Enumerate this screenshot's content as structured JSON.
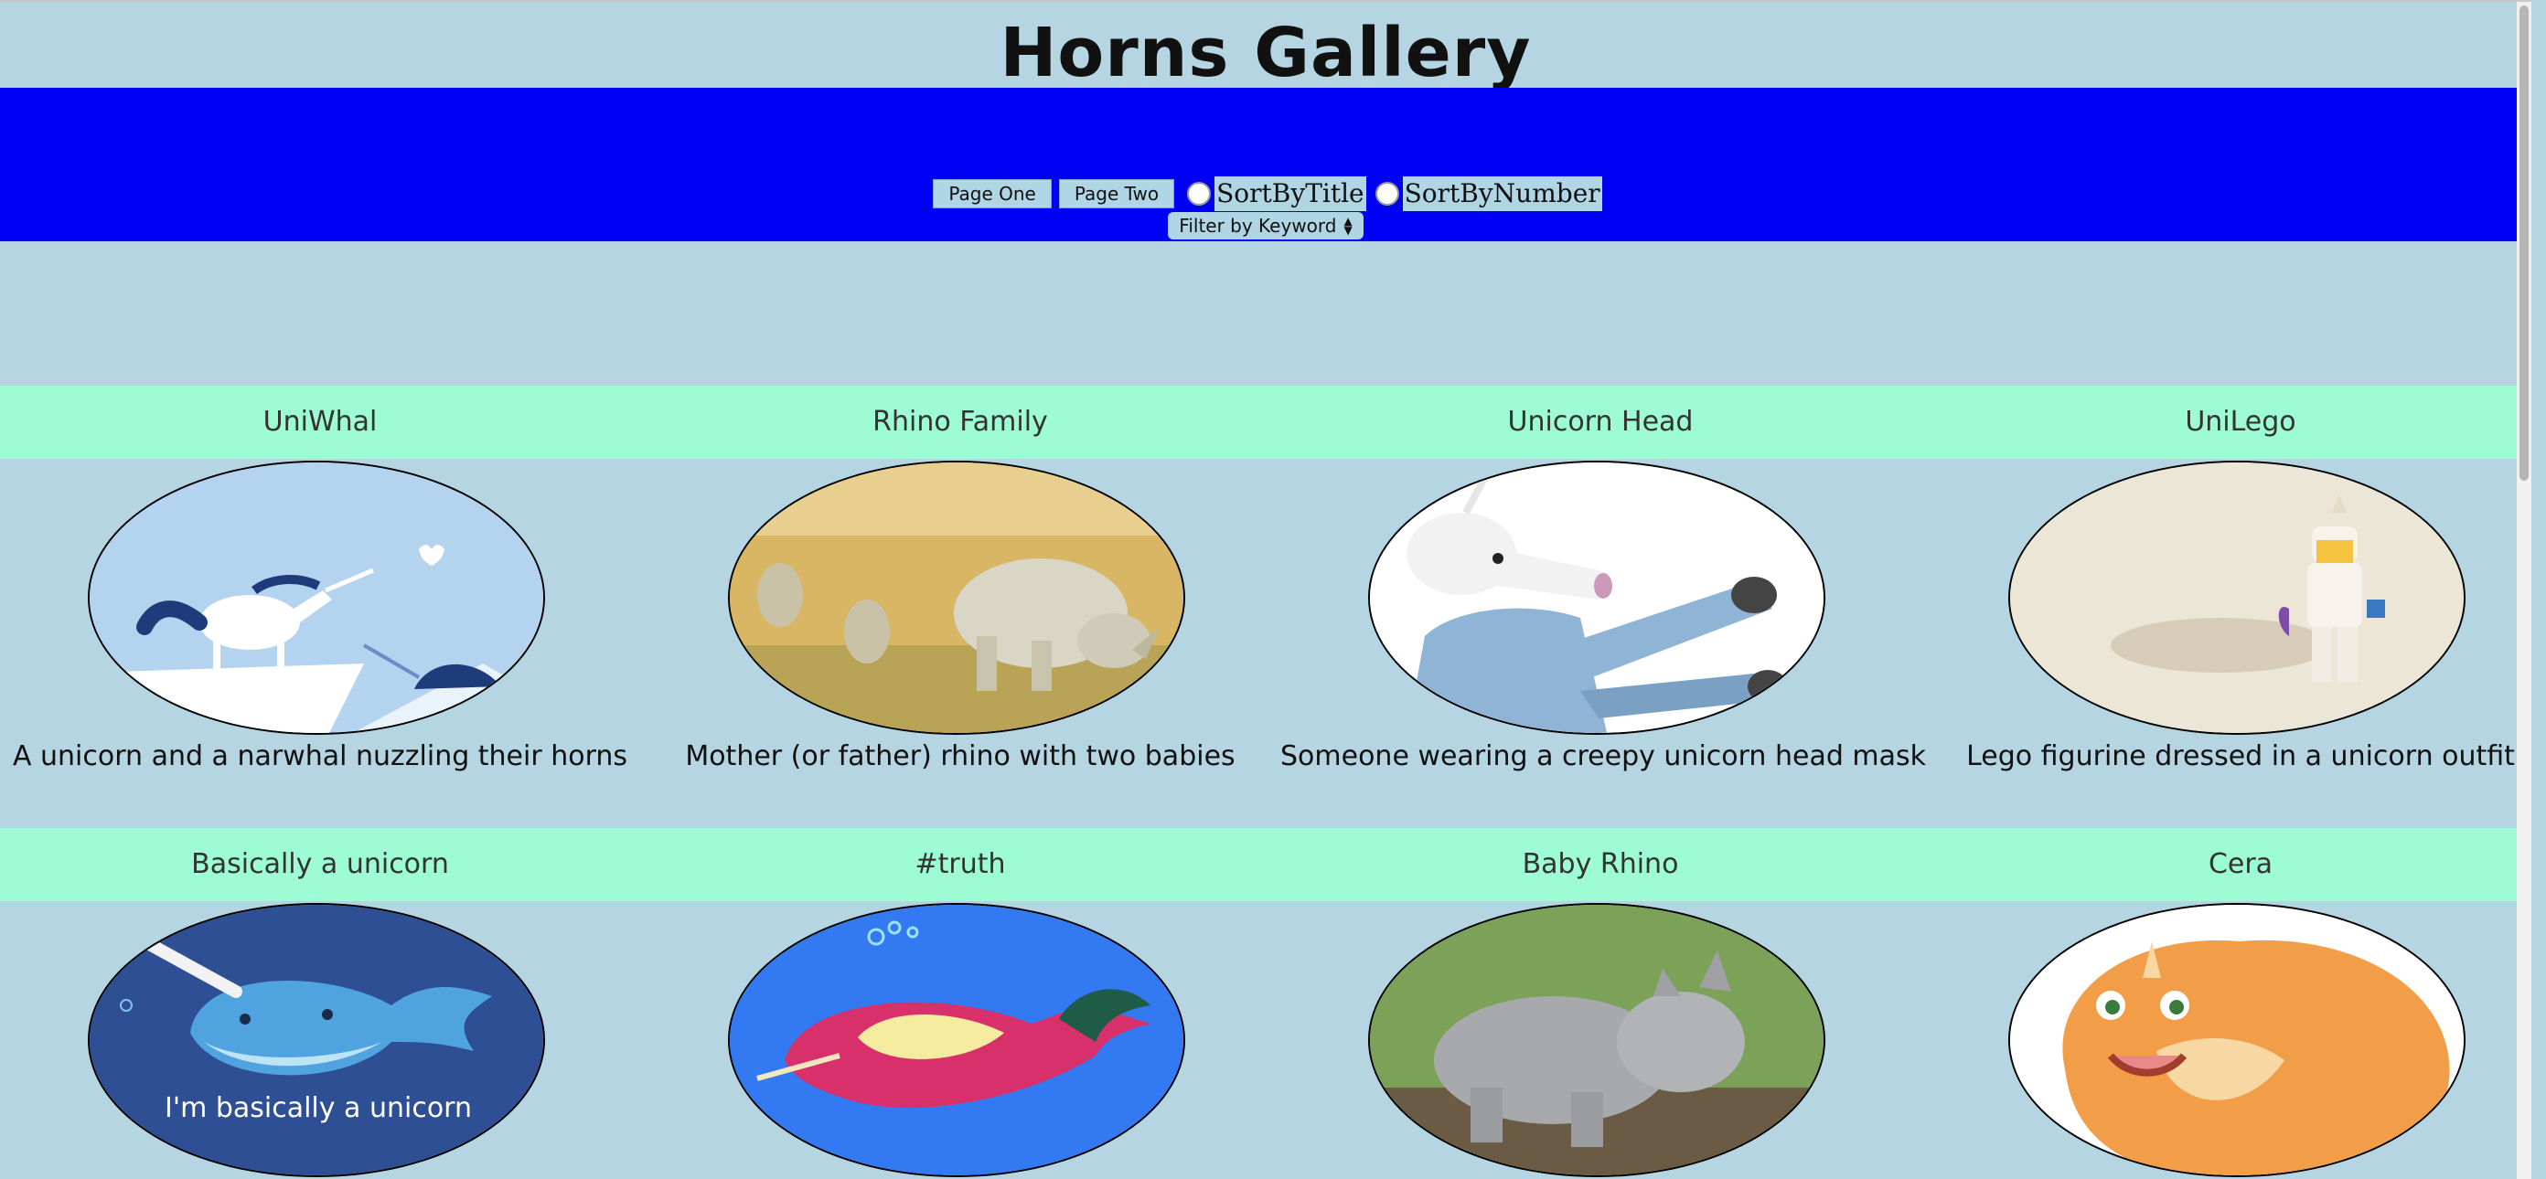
{
  "header": {
    "title": "Horns Gallery"
  },
  "nav": {
    "page_one": "Page One",
    "page_two": "Page Two",
    "sort_title": "SortByTitle",
    "sort_number": "SortByNumber",
    "filter": "Filter by Keyword"
  },
  "gallery": [
    {
      "title": "UniWhal",
      "caption": "A unicorn and a narwhal nuzzling their horns",
      "image": "unicorn-narwhal-illustration"
    },
    {
      "title": "Rhino Family",
      "caption": "Mother (or father) rhino with two babies",
      "image": "rhino-family-photo"
    },
    {
      "title": "Unicorn Head",
      "caption": "Someone wearing a creepy unicorn head mask",
      "image": "unicorn-mask-photo"
    },
    {
      "title": "UniLego",
      "caption": "Lego figurine dressed in a unicorn outfit",
      "image": "lego-unicorn-photo"
    },
    {
      "title": "Basically a unicorn",
      "caption": "",
      "image": "narwhal-cartoon",
      "image_text": "I'm basically a unicorn"
    },
    {
      "title": "#truth",
      "caption": "",
      "image": "narwhal-drawing"
    },
    {
      "title": "Baby Rhino",
      "caption": "",
      "image": "baby-rhino-photo"
    },
    {
      "title": "Cera",
      "caption": "",
      "image": "triceratops-cartoon"
    }
  ],
  "colors": {
    "background": "#b4d5e1",
    "nav": "#0000f5",
    "title_band": "#9dfcd4"
  }
}
